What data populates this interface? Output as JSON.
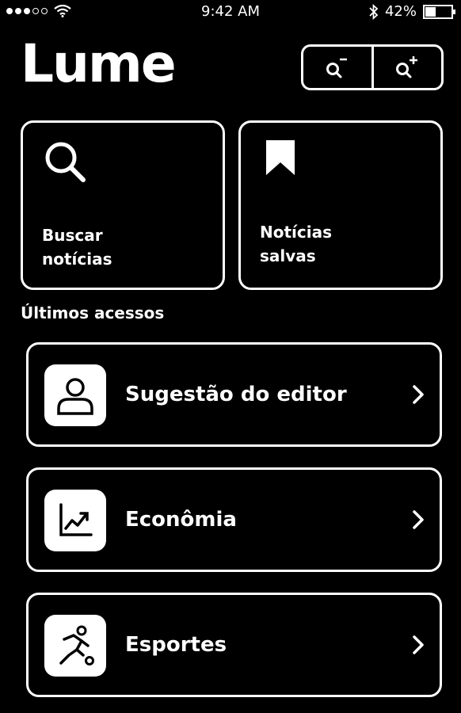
{
  "status_bar": {
    "time": "9:42 AM",
    "battery_text": "42%",
    "battery_level": 0.42,
    "signal_bars_filled": 3,
    "signal_bars_total": 5
  },
  "header": {
    "logo": "Lume",
    "zoom_out_icon": "zoom-out-icon",
    "zoom_in_icon": "zoom-in-icon"
  },
  "cards": {
    "search": {
      "label_line1": "Buscar",
      "label_line2": "notícias",
      "icon": "search-icon"
    },
    "saved": {
      "label_line1": "Notícias",
      "label_line2": "salvas",
      "icon": "bookmark-icon"
    }
  },
  "recent": {
    "title": "Últimos acessos",
    "items": [
      {
        "label": "Sugestão do editor",
        "icon": "user-icon"
      },
      {
        "label": "Econômia",
        "icon": "chart-icon"
      },
      {
        "label": "Esportes",
        "icon": "runner-icon"
      }
    ]
  },
  "colors": {
    "background": "#000000",
    "foreground": "#ffffff"
  }
}
